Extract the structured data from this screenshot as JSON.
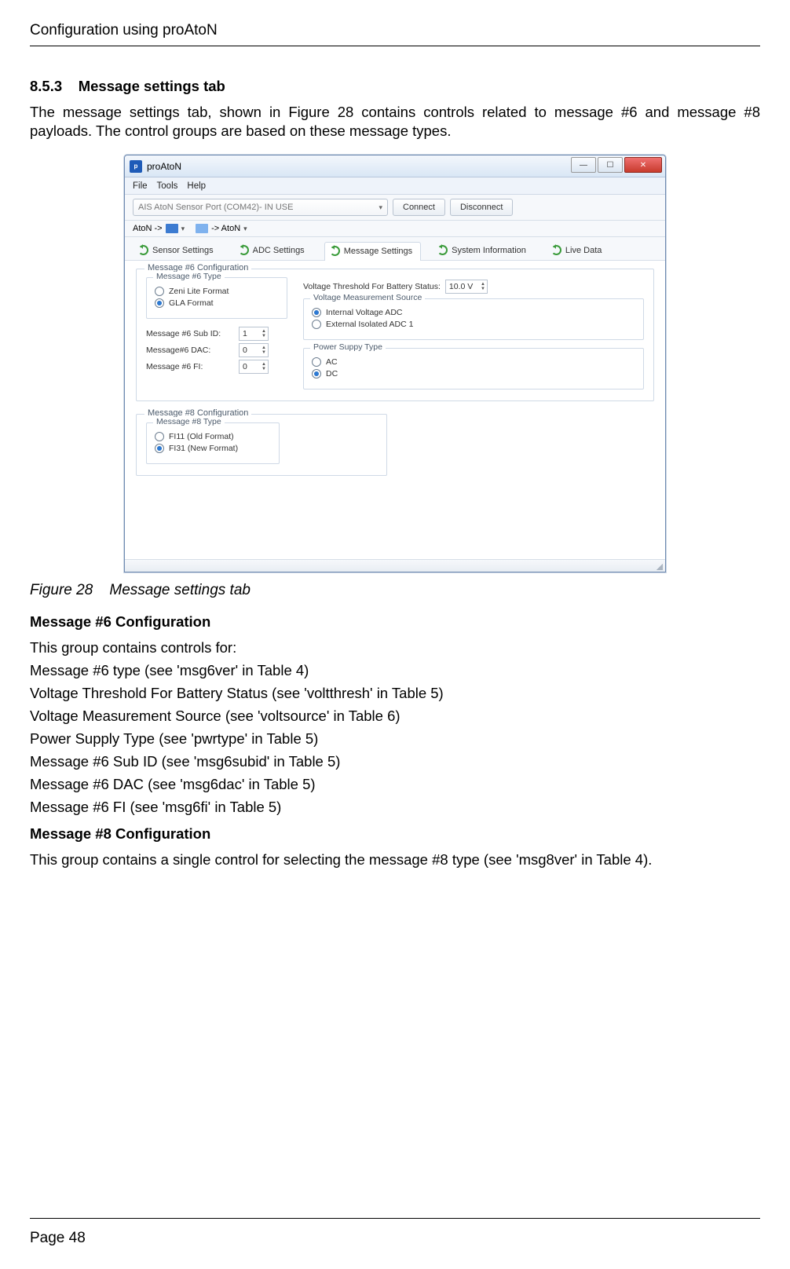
{
  "page": {
    "running_head": "Configuration using proAtoN",
    "section_number": "8.5.3",
    "section_title": "Message settings tab",
    "intro": "The message settings tab, shown in Figure 28 contains controls related to message #6 and message #8 payloads. The control groups are based on these message types.",
    "figure_caption_label": "Figure 28",
    "figure_caption_text": "Message settings tab",
    "msg6_head": "Message #6 Configuration",
    "msg6_intro": "This group contains controls for:",
    "msg6_lines": [
      "Message #6 type (see 'msg6ver' in Table 4)",
      "Voltage Threshold For Battery Status (see 'voltthresh' in Table 5)",
      "Voltage Measurement Source (see 'voltsource' in Table 6)",
      "Power Supply Type (see 'pwrtype' in Table 5)",
      "Message #6 Sub ID (see 'msg6subid' in Table 5)",
      "Message #6 DAC (see 'msg6dac' in Table 5)",
      "Message #6 FI (see 'msg6fi' in Table 5)"
    ],
    "msg8_head": "Message #8 Configuration",
    "msg8_text": "This group contains a single control for selecting the message #8 type (see 'msg8ver' in Table 4).",
    "footer": "Page 48"
  },
  "app": {
    "title": "proAtoN",
    "menu": {
      "file": "File",
      "tools": "Tools",
      "help": "Help"
    },
    "port_combo": "AIS AtoN Sensor Port (COM42)- IN USE",
    "connect": "Connect",
    "disconnect": "Disconnect",
    "flow": {
      "left": "AtoN ->",
      "right": "-> AtoN"
    },
    "tabs": {
      "sensor": "Sensor Settings",
      "adc": "ADC Settings",
      "message": "Message Settings",
      "sysinfo": "System Information",
      "live": "Live Data"
    },
    "msg6": {
      "group": "Message #6 Configuration",
      "type_group": "Message #6 Type",
      "type_zeni": "Zeni Lite Format",
      "type_gla": "GLA Format",
      "subid_label": "Message #6 Sub ID:",
      "subid_val": "1",
      "dac_label": "Message#6 DAC:",
      "dac_val": "0",
      "fi_label": "Message #6 FI:",
      "fi_val": "0",
      "volt_thresh_label": "Voltage Threshold For Battery Status:",
      "volt_thresh_val": "10.0 V",
      "vms_group": "Voltage Measurement Source",
      "vms_internal": "Internal Voltage ADC",
      "vms_external": "External Isolated ADC 1",
      "psu_group": "Power Suppy Type",
      "psu_ac": "AC",
      "psu_dc": "DC"
    },
    "msg8": {
      "group": "Message #8 Configuration",
      "type_group": "Message #8 Type",
      "old": "FI11 (Old Format)",
      "new": "FI31 (New Format)"
    }
  }
}
